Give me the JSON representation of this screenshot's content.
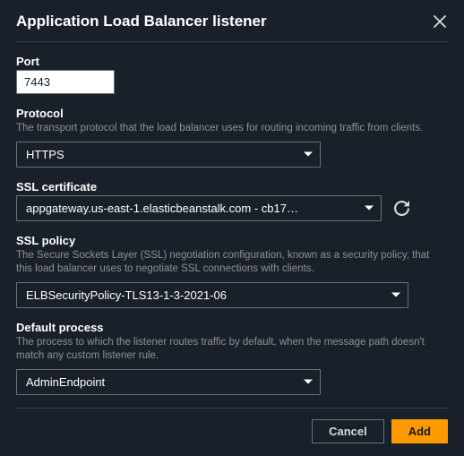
{
  "modal": {
    "title": "Application Load Balancer listener"
  },
  "fields": {
    "port": {
      "label": "Port",
      "value": "7443"
    },
    "protocol": {
      "label": "Protocol",
      "desc": "The transport protocol that the load balancer uses for routing incoming traffic from clients.",
      "value": "HTTPS"
    },
    "ssl_certificate": {
      "label": "SSL certificate",
      "value": "appgateway.us-east-1.elasticbeanstalk.com - cb17…"
    },
    "ssl_policy": {
      "label": "SSL policy",
      "desc": "The Secure Sockets Layer (SSL) negotiation configuration, known as a security policy, that this load balancer uses to negotiate SSL connections with clients.",
      "value": "ELBSecurityPolicy-TLS13-1-3-2021-06"
    },
    "default_process": {
      "label": "Default process",
      "desc": "The process to which the listener routes traffic by default, when the message path doesn't match any custom listener rule.",
      "value": "AdminEndpoint"
    }
  },
  "footer": {
    "cancel": "Cancel",
    "add": "Add"
  }
}
